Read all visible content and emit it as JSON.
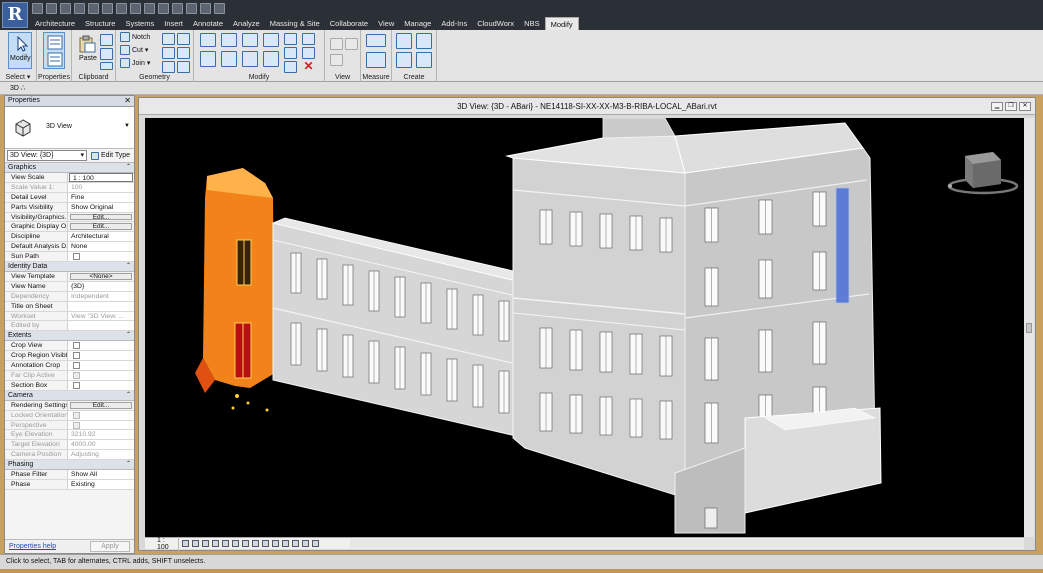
{
  "app": {
    "logo_letter": "R"
  },
  "menu": {
    "tabs": [
      "Architecture",
      "Structure",
      "Systems",
      "Insert",
      "Annotate",
      "Analyze",
      "Massing & Site",
      "Collaborate",
      "View",
      "Manage",
      "Add-Ins",
      "CloudWorx",
      "NBS",
      "Modify"
    ],
    "active": "Modify"
  },
  "ribbon": {
    "select": {
      "modify_label": "Modify",
      "panel_label": "Select ▾"
    },
    "properties_panel": {
      "panel_label": "Properties"
    },
    "clipboard": {
      "paste_label": "Paste",
      "panel_label": "Clipboard"
    },
    "geometry": {
      "notch_label": "Notch",
      "cut_label": "Cut",
      "join_label": "Join",
      "panel_label": "Geometry"
    },
    "modify": {
      "panel_label": "Modify"
    },
    "view": {
      "panel_label": "View"
    },
    "measure": {
      "panel_label": "Measure"
    },
    "create": {
      "panel_label": "Create"
    }
  },
  "optionsbar": {
    "text": "3D  ∴"
  },
  "properties": {
    "title": "Properties",
    "close": "✕",
    "type_name": "3D View",
    "instance_label": "3D View: {3D}",
    "edit_type_label": "Edit Type",
    "sections": {
      "graphics": "Graphics",
      "identity": "Identity Data",
      "extents": "Extents",
      "camera": "Camera",
      "phasing": "Phasing"
    },
    "graphics": {
      "view_scale": {
        "label": "View Scale",
        "value": "1 : 100"
      },
      "scale_value": {
        "label": "Scale Value    1:",
        "value": "100"
      },
      "detail_level": {
        "label": "Detail Level",
        "value": "Fine"
      },
      "parts_visibility": {
        "label": "Parts Visibility",
        "value": "Show Original"
      },
      "vis_graphics": {
        "label": "Visibility/Graphics...",
        "value": "Edit..."
      },
      "graphic_display": {
        "label": "Graphic Display O...",
        "value": "Edit..."
      },
      "discipline": {
        "label": "Discipline",
        "value": "Architectural"
      },
      "default_analysis": {
        "label": "Default Analysis D...",
        "value": "None"
      },
      "sun_path": {
        "label": "Sun Path"
      }
    },
    "identity": {
      "view_template": {
        "label": "View Template",
        "value": "<None>"
      },
      "view_name": {
        "label": "View Name",
        "value": "{3D}"
      },
      "dependency": {
        "label": "Dependency",
        "value": "Independent"
      },
      "title_on_sheet": {
        "label": "Title on Sheet",
        "value": ""
      },
      "workset": {
        "label": "Workset",
        "value": "View \"3D View: ..."
      },
      "edited_by": {
        "label": "Edited by",
        "value": ""
      }
    },
    "extents": {
      "crop_view": {
        "label": "Crop View"
      },
      "crop_region_visible": {
        "label": "Crop Region Visible"
      },
      "annotation_crop": {
        "label": "Annotation Crop"
      },
      "far_clip_active": {
        "label": "Far Clip Active"
      },
      "section_box": {
        "label": "Section Box"
      }
    },
    "camera": {
      "rendering_settings": {
        "label": "Rendering Settings",
        "value": "Edit..."
      },
      "locked_orientation": {
        "label": "Locked Orientation"
      },
      "perspective": {
        "label": "Perspective"
      },
      "eye_elevation": {
        "label": "Eye Elevation",
        "value": "3210.92"
      },
      "target_elevation": {
        "label": "Target Elevation",
        "value": "4000.00"
      },
      "camera_position": {
        "label": "Camera Position",
        "value": "Adjusting"
      }
    },
    "phasing": {
      "phase_filter": {
        "label": "Phase Filter",
        "value": "Show All"
      },
      "phase": {
        "label": "Phase",
        "value": "Existing"
      }
    },
    "help_link": "Properties help",
    "apply_label": "Apply"
  },
  "view": {
    "title": "3D View: {3D - ABari} - NE14118-SI-XX-XX-M3-B-RIBA-LOCAL_ABari.rvt",
    "scale": "1 : 100"
  },
  "status": {
    "text": "Click to select, TAB for alternates, CTRL adds, SHIFT unselects."
  },
  "colors": {
    "canvas_bg": "#000000",
    "pointcloud": "#ff8a1c",
    "model": "#d6d6d6",
    "selection": "#4a6ed8"
  }
}
